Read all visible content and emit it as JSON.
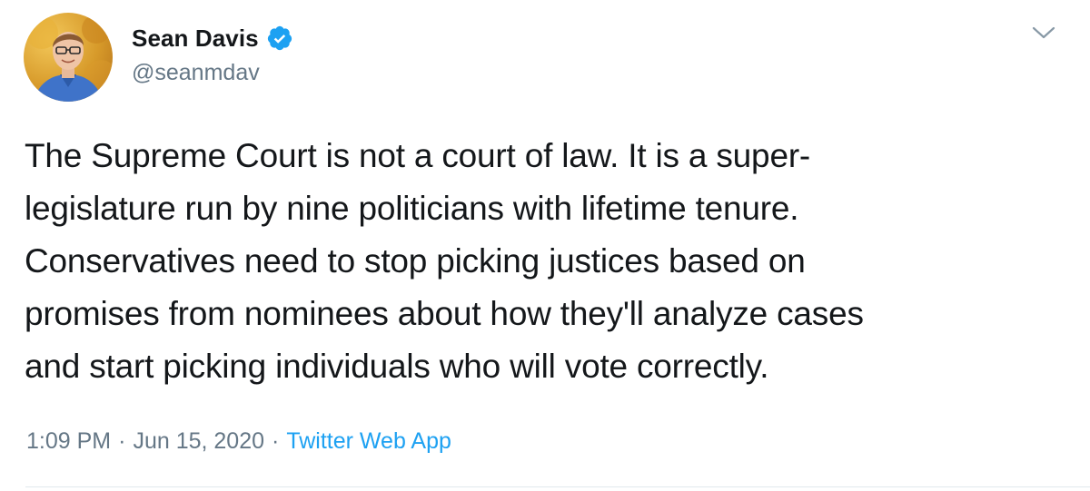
{
  "author": {
    "display_name": "Sean Davis",
    "handle": "@seanmdav",
    "verified": true,
    "avatar_icon": "user-avatar"
  },
  "tweet": {
    "text": "The Supreme Court is not a court of law. It is a super-\nlegislature run by nine politicians with lifetime tenure.\nConservatives need to stop picking justices based on\npromises from nominees about how they'll analyze cases\nand start picking individuals who will vote correctly.",
    "time": "1:09 PM",
    "separator": "·",
    "date": "Jun 15, 2020",
    "source": "Twitter Web App"
  },
  "colors": {
    "text": "#14171a",
    "secondary": "#657786",
    "accent": "#1da1f2",
    "divider": "#e1e8ed"
  },
  "icons": {
    "verified": "verified-badge-icon",
    "menu": "chevron-down-icon"
  }
}
